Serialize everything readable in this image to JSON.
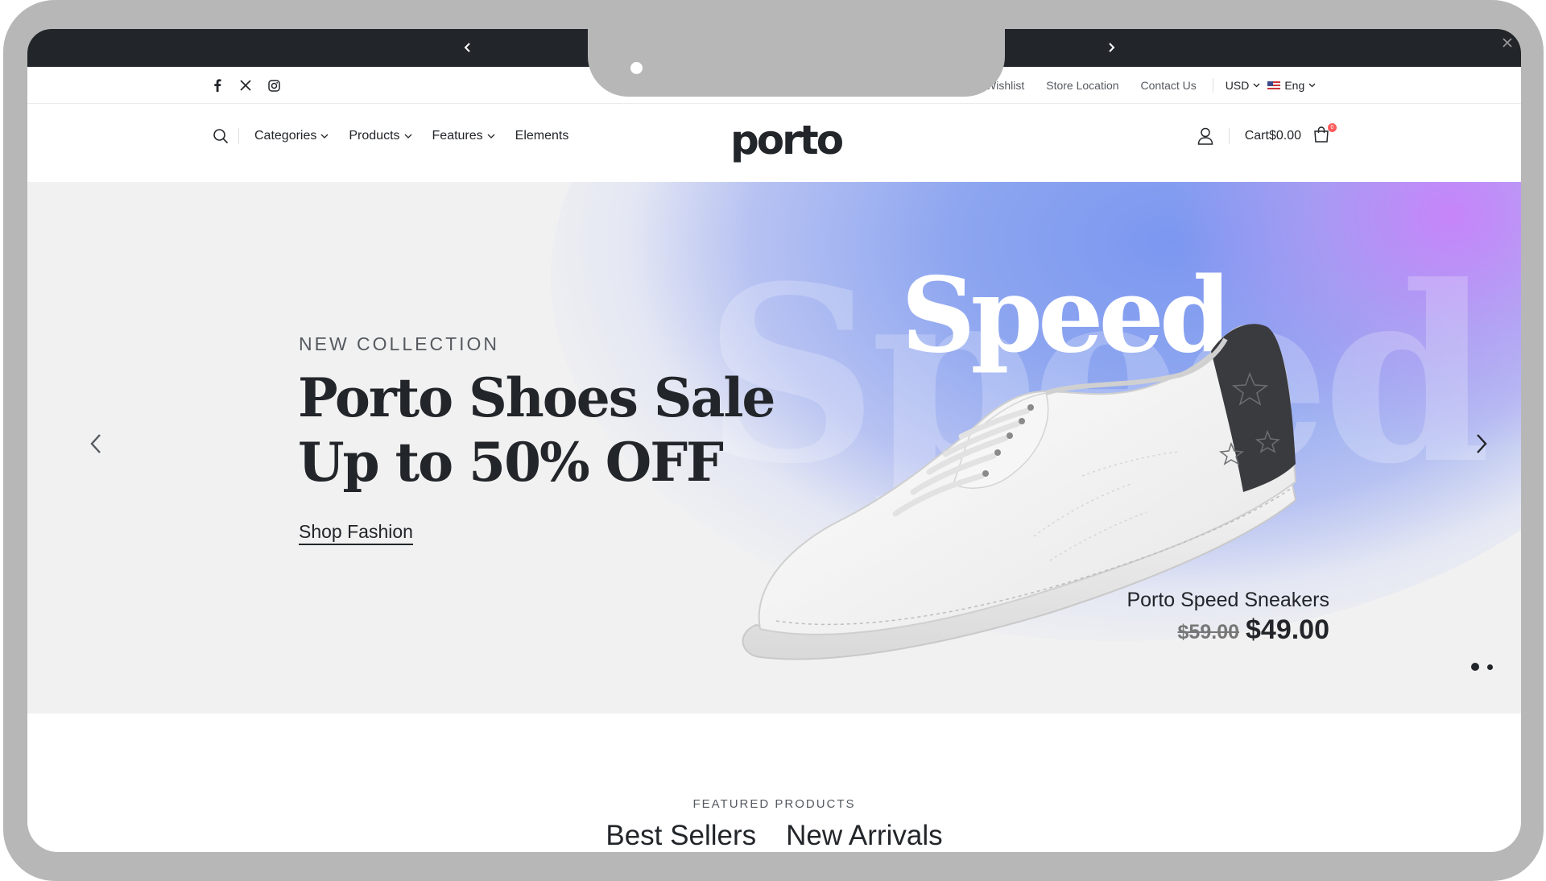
{
  "promo": {
    "prev_icon": "chevron-left-icon",
    "next_icon": "chevron-right-icon",
    "close_icon": "close-icon"
  },
  "topbar": {
    "social": [
      "facebook-icon",
      "x-icon",
      "instagram-icon"
    ],
    "links": [
      "Wishlist",
      "Store Location",
      "Contact Us"
    ],
    "currency": "USD",
    "language": "Eng"
  },
  "header": {
    "logo": "porto",
    "nav": [
      "Categories",
      "Products",
      "Features",
      "Elements"
    ],
    "cart_label": "Cart",
    "cart_total": "$0.00",
    "cart_count": "0"
  },
  "hero": {
    "eyebrow": "NEW COLLECTION",
    "headline_line1": "Porto Shoes Sale",
    "headline_line2": "Up to 50% OFF",
    "cta": "Shop Fashion",
    "image_word": "Speed",
    "product_name": "Porto Speed Sneakers",
    "price_old": "$59.00",
    "price_new": "$49.00",
    "slide_count": 2,
    "active_slide": 1,
    "colors": {
      "accent_blue": "#7b97f0",
      "accent_purple": "#c882fa",
      "ink": "#222529"
    }
  },
  "featured": {
    "label": "FEATURED PRODUCTS",
    "tabs": [
      "Best Sellers",
      "New Arrivals"
    ],
    "active_tab": "Best Sellers"
  }
}
